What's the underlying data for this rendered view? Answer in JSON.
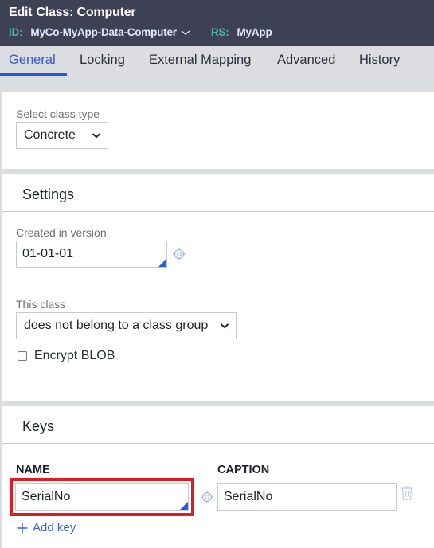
{
  "header": {
    "title_prefix": "Edit",
    "title": "Class: Computer",
    "id_label": "ID:",
    "id_value": "MyCo-MyApp-Data-Computer",
    "rs_label": "RS:",
    "rs_value": "MyApp"
  },
  "tabs": [
    {
      "label": "General",
      "active": true
    },
    {
      "label": "Locking",
      "active": false
    },
    {
      "label": "External Mapping",
      "active": false
    },
    {
      "label": "Advanced",
      "active": false
    },
    {
      "label": "History",
      "active": false
    }
  ],
  "general": {
    "class_type_label": "Select class type",
    "class_type_value": "Concrete"
  },
  "settings": {
    "title": "Settings",
    "created_in_version_label": "Created in version",
    "created_in_version_value": "01-01-01",
    "this_class_label": "This class",
    "this_class_value": "does not belong to a class group",
    "encrypt_blob_label": "Encrypt BLOB",
    "encrypt_blob_checked": false
  },
  "keys": {
    "title": "Keys",
    "name_header": "NAME",
    "caption_header": "CAPTION",
    "rows": [
      {
        "name": "SerialNo",
        "caption": "SerialNo"
      }
    ],
    "add_key_label": "Add key"
  },
  "colors": {
    "header_bg": "#3e4154",
    "accent": "#2755f0",
    "id_label": "#4fb2a6",
    "highlight": "#e11b22"
  }
}
